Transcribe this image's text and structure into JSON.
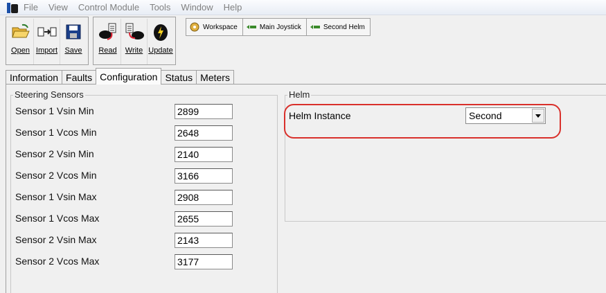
{
  "menu": [
    "File",
    "View",
    "Control Module",
    "Tools",
    "Window",
    "Help"
  ],
  "toolbar": {
    "main_buttons": [
      {
        "label": "Open",
        "icon": "folder-open-icon"
      },
      {
        "label": "Import",
        "icon": "import-icon"
      },
      {
        "label": "Save",
        "icon": "floppy-disk-icon"
      }
    ],
    "device_buttons": [
      {
        "label": "Read",
        "icon": "read-device-icon"
      },
      {
        "label": "Write",
        "icon": "write-device-icon"
      },
      {
        "label": "Update",
        "icon": "update-device-icon"
      }
    ],
    "small_buttons": [
      {
        "label": "Workspace",
        "icon": "workspace-icon"
      },
      {
        "label": "Main Joystick",
        "icon": "joystick-icon"
      },
      {
        "label": "Second Helm",
        "icon": "helm-icon"
      }
    ]
  },
  "tabs": [
    {
      "label": "Information",
      "active": false
    },
    {
      "label": "Faults",
      "active": false
    },
    {
      "label": "Configuration",
      "active": true
    },
    {
      "label": "Status",
      "active": false
    },
    {
      "label": "Meters",
      "active": false
    }
  ],
  "steering_sensors": {
    "title": "Steering Sensors",
    "rows": [
      {
        "label": "Sensor 1 Vsin Min",
        "value": "2899"
      },
      {
        "label": "Sensor 1 Vcos Min",
        "value": "2648"
      },
      {
        "label": "Sensor 2 Vsin Min",
        "value": "2140"
      },
      {
        "label": "Sensor 2 Vcos Min",
        "value": "3166"
      },
      {
        "label": "Sensor 1 Vsin Max",
        "value": "2908"
      },
      {
        "label": "Sensor 1 Vcos Max",
        "value": "2655"
      },
      {
        "label": "Sensor 2 Vsin Max",
        "value": "2143"
      },
      {
        "label": "Sensor 2 Vcos Max",
        "value": "3177"
      }
    ]
  },
  "helm": {
    "title": "Helm",
    "instance_label": "Helm Instance",
    "instance_value": "Second"
  },
  "colors": {
    "highlight": "#d9302b",
    "app_icon_blue": "#1a4fa8"
  }
}
